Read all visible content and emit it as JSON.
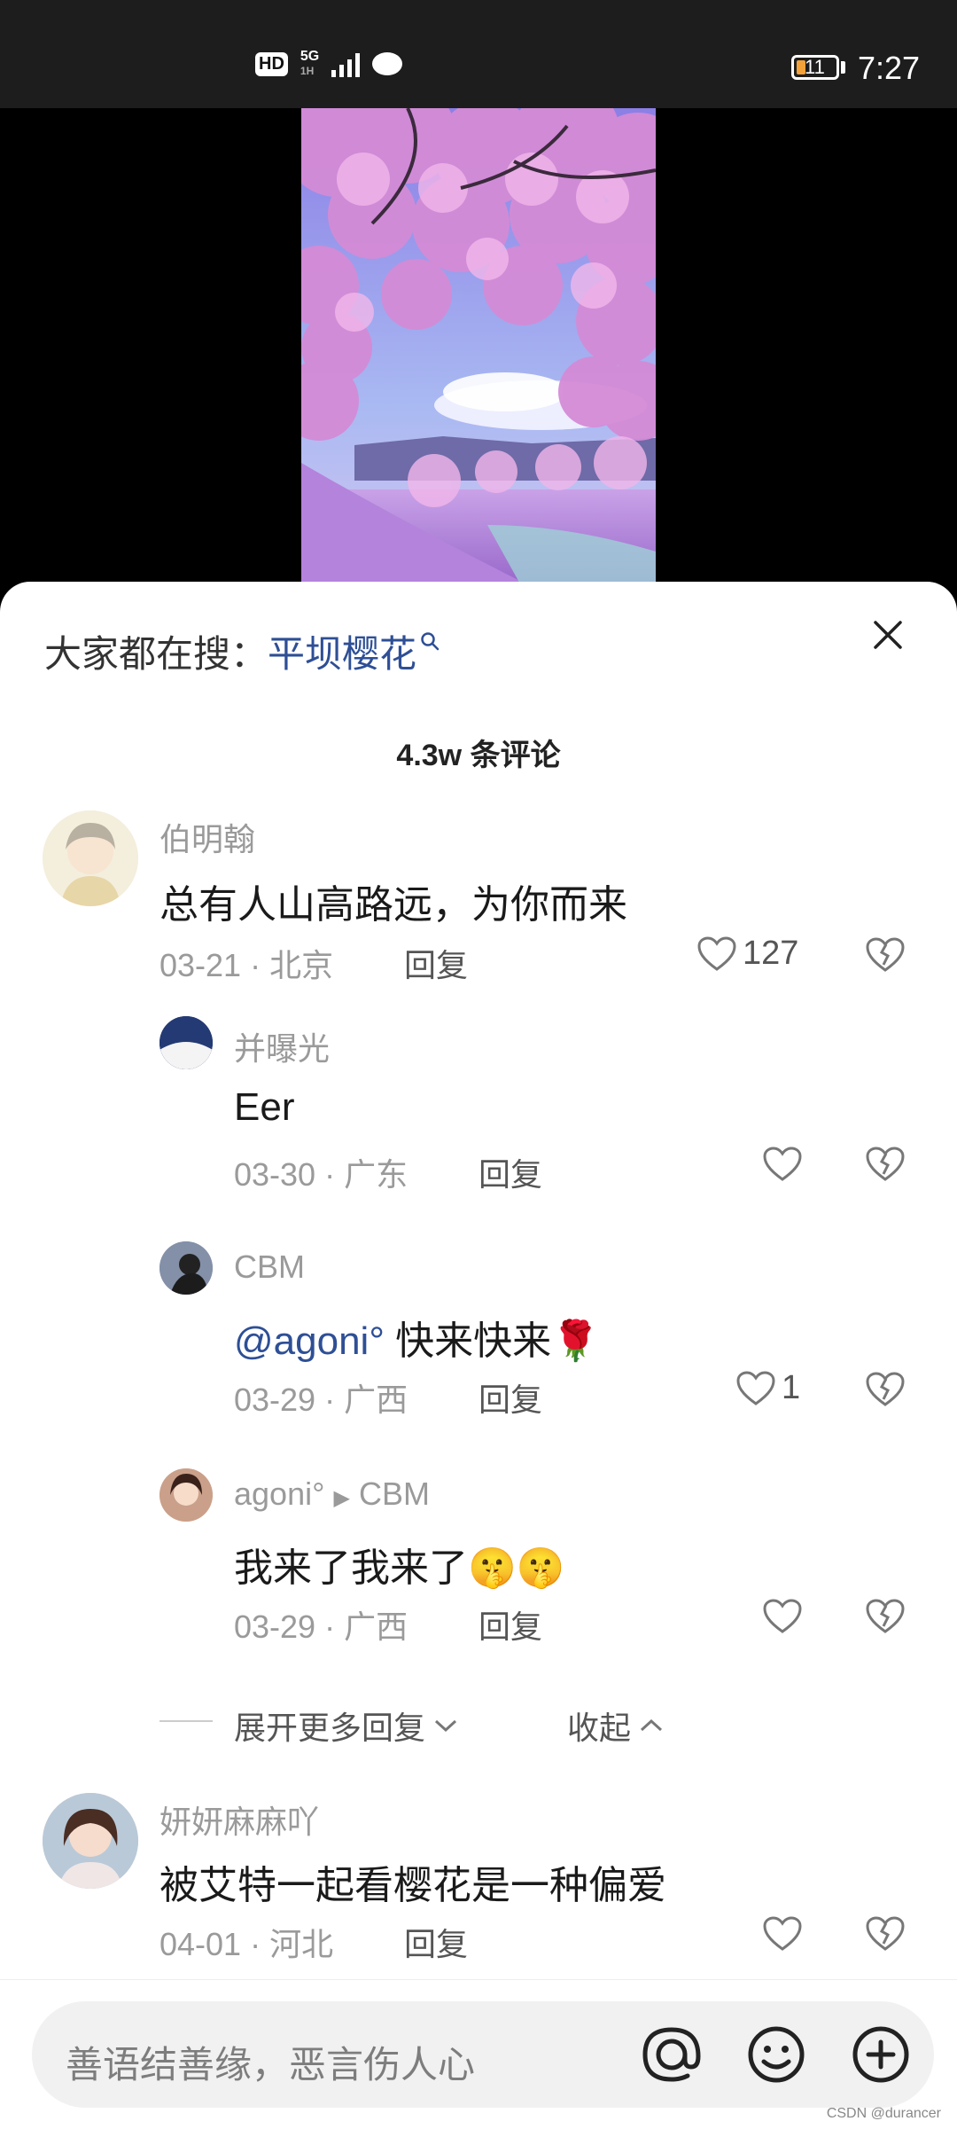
{
  "status_bar": {
    "hd": "HD",
    "network": "5G",
    "network_sub": "1H",
    "battery_level": "11",
    "time": "7:27"
  },
  "sheet": {
    "search_prefix": "大家都在搜：",
    "search_keyword": "平坝樱花",
    "comment_count": "4.3w 条评论"
  },
  "comments": [
    {
      "name": "伯明翰",
      "text": "总有人山高路远，为你而来",
      "date": "03-21",
      "location": "北京",
      "reply": "回复",
      "likes": "127"
    },
    {
      "name": "并曝光",
      "text": "Eer",
      "date": "03-30",
      "location": "广东",
      "reply": "回复",
      "likes": ""
    },
    {
      "name": "CBM",
      "mention": "@agoni°",
      "text": " 快来快来",
      "emoji": "🌹",
      "date": "03-29",
      "location": "广西",
      "reply": "回复",
      "likes": "1"
    },
    {
      "name": "agoni°",
      "reply_to": "CBM",
      "text": "我来了我来了",
      "date": "03-29",
      "location": "广西",
      "reply": "回复",
      "likes": ""
    },
    {
      "name": "妍妍麻麻吖",
      "text": "被艾特一起看樱花是一种偏爱",
      "date": "04-01",
      "location": "河北",
      "reply": "回复",
      "likes": ""
    }
  ],
  "expand": {
    "more": "展开更多回复",
    "collapse": "收起"
  },
  "input": {
    "placeholder": "善语结善缘，恶言伤人心"
  },
  "watermark": "CSDN @durancer",
  "colors": {
    "link": "#2e4f96",
    "meta": "#9a9a9a",
    "sheet": "#ffffff"
  }
}
